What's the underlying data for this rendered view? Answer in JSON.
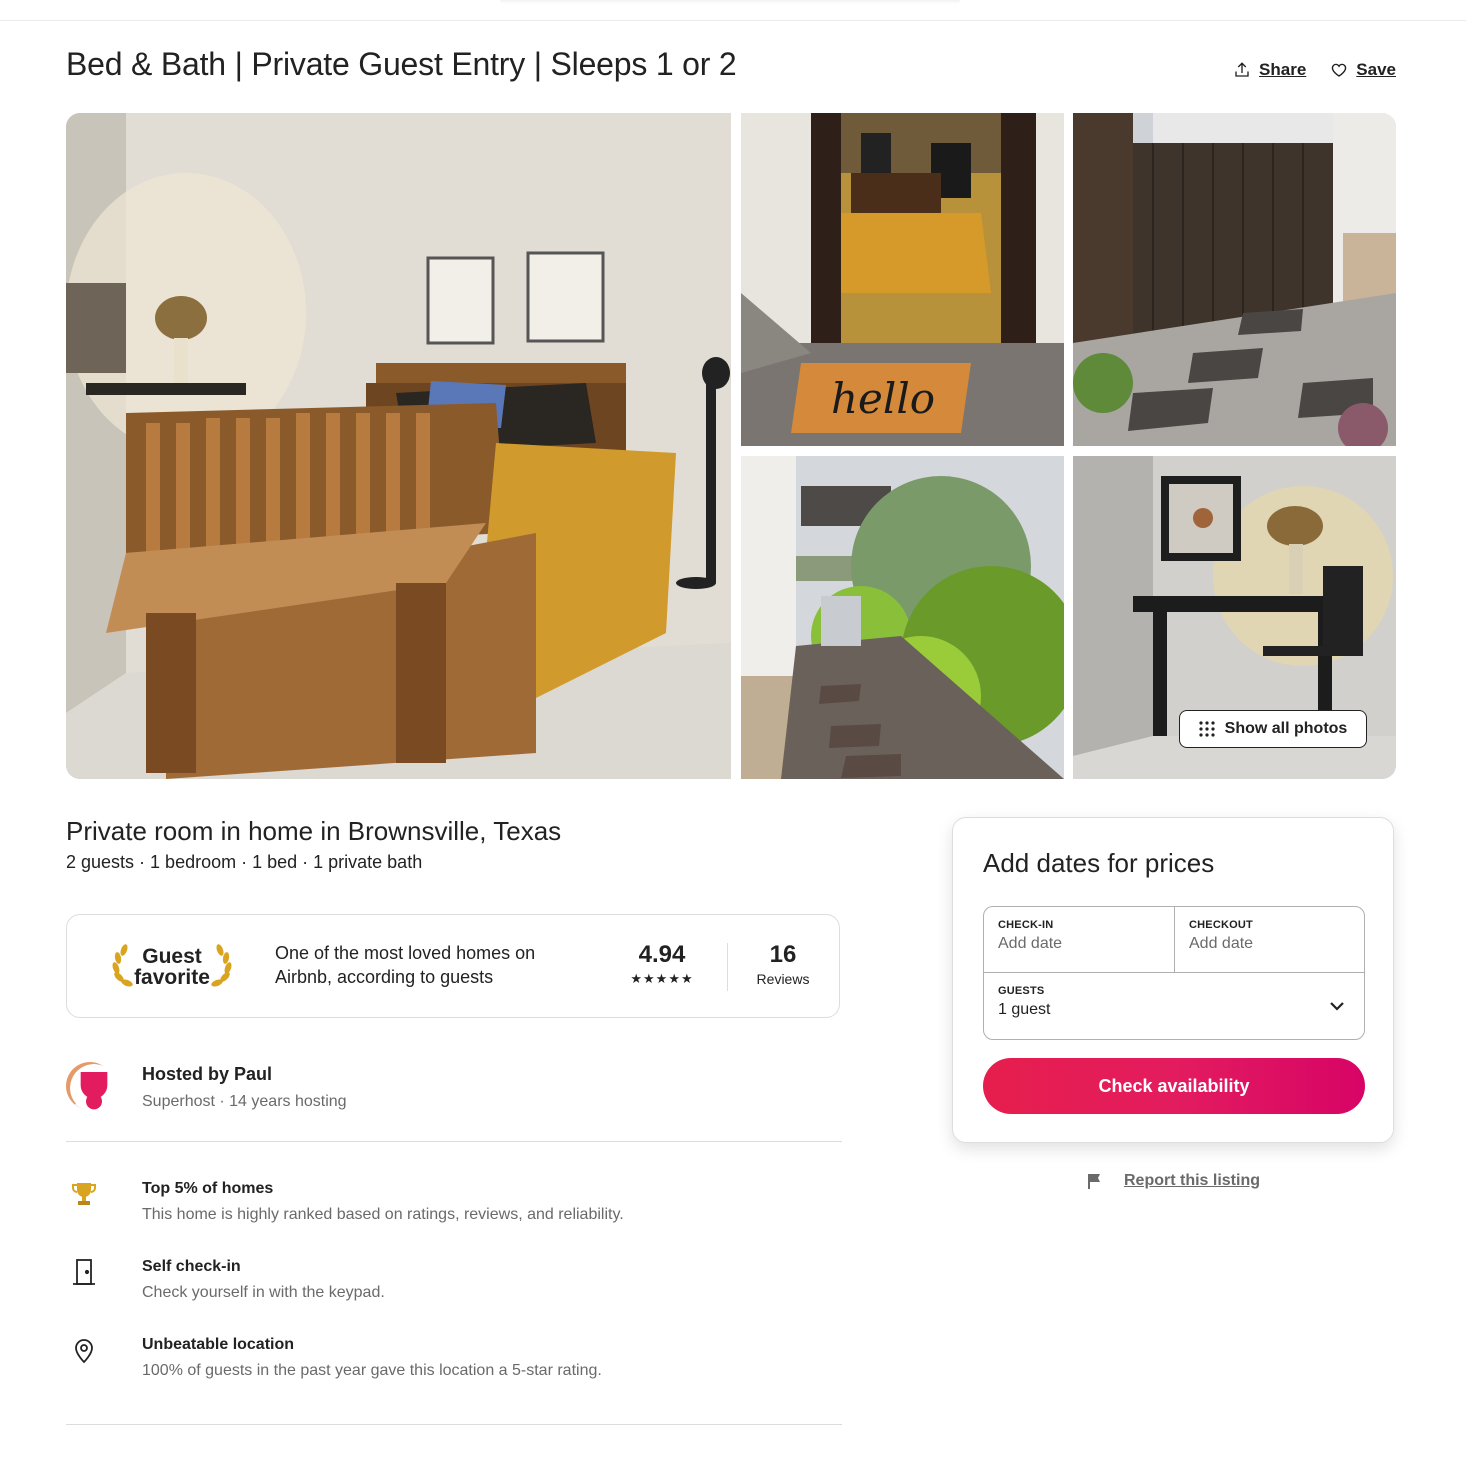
{
  "listing": {
    "title": "Bed & Bath | Private Guest Entry | Sleeps 1 or 2",
    "share_label": "Share",
    "save_label": "Save",
    "show_all_photos_label": "Show all photos",
    "subtitle": "Private room in home in Brownsville, Texas",
    "details": "2 guests · 1 bedroom · 1 bed · 1 private bath"
  },
  "guest_favorite": {
    "label_line1": "Guest",
    "label_line2": "favorite",
    "description": "One of the most loved homes on Airbnb, according to guests",
    "rating": "4.94",
    "stars": "★★★★★",
    "reviews_count": "16",
    "reviews_label": "Reviews"
  },
  "host": {
    "name": "Hosted by Paul",
    "subtitle": "Superhost · 14 years hosting"
  },
  "highlights": [
    {
      "icon": "trophy-icon",
      "title": "Top 5% of homes",
      "text": "This home is highly ranked based on ratings, reviews, and reliability."
    },
    {
      "icon": "door-icon",
      "title": "Self check-in",
      "text": "Check yourself in with the keypad."
    },
    {
      "icon": "location-pin-icon",
      "title": "Unbeatable location",
      "text": "100% of guests in the past year gave this location a 5-star rating."
    }
  ],
  "booking": {
    "heading": "Add dates for prices",
    "checkin_label": "CHECK-IN",
    "checkin_value": "Add date",
    "checkout_label": "CHECKOUT",
    "checkout_value": "Add date",
    "guests_label": "GUESTS",
    "guests_value": "1 guest",
    "cta_label": "Check availability",
    "report_label": "Report this listing"
  },
  "colors": {
    "brand": "#e31c5f",
    "text": "#222222",
    "muted": "#6a6a6a",
    "border": "#dddddd",
    "gold": "#d9a520"
  }
}
